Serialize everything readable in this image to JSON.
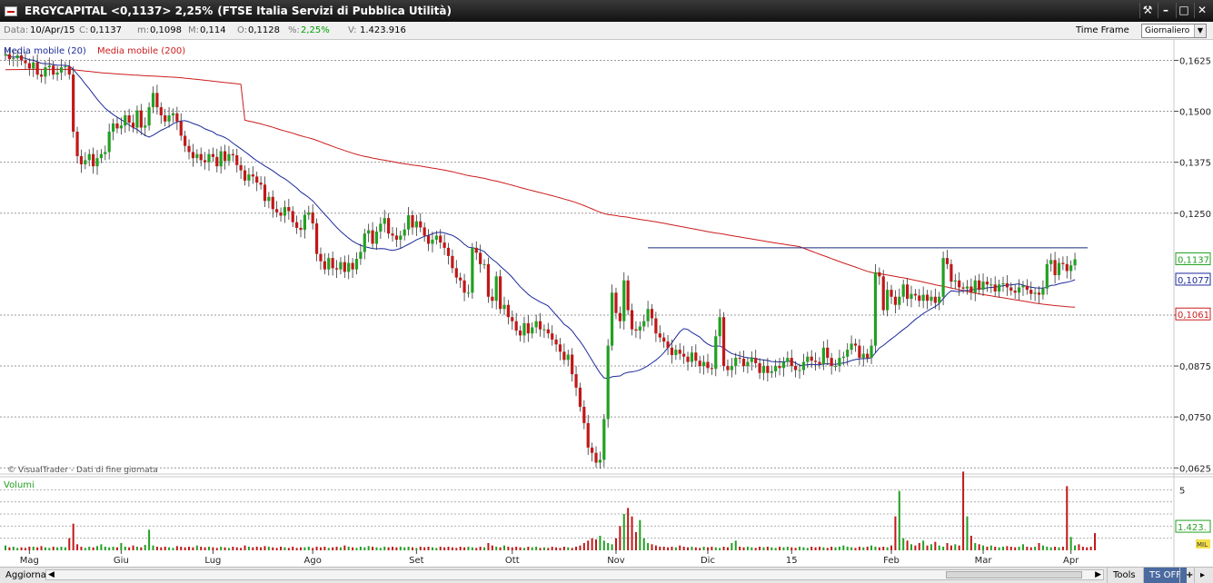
{
  "window": {
    "title_symbol": "ERGYCAPITAL <0,1137> 2,25%",
    "title_index": "(FTSE Italia Servizi di Pubblica Utilità)",
    "buttons": [
      "tools-icon",
      "minimize-icon",
      "maximize-icon",
      "close-icon"
    ]
  },
  "infobar": {
    "data_label": "Data:",
    "data_value": "10/Apr/15",
    "close_label": "C:",
    "close_value": "0,1137",
    "min_label": "m:",
    "min_value": "0,1098",
    "max_label": "M:",
    "max_value": "0,114",
    "open_label": "O:",
    "open_value": "0,1128",
    "pct_label": "%:",
    "pct_value": "2,25%",
    "vol_label": "V:",
    "vol_value": "1.423.916",
    "timeframe_label": "Time Frame",
    "timeframe_value": "Giornaliero"
  },
  "legend": {
    "ma20": "Media mobile (20)",
    "ma200": "Media mobile (200)",
    "volumes": "Volumi",
    "watermark": "© VisualTrader - Dati di fine giornata"
  },
  "bottom": {
    "refresh": "Aggiorna",
    "tools": "Tools",
    "tsoff": "TS OFF",
    "plus": "+"
  },
  "colors": {
    "up": "#22a022",
    "down": "#c01818",
    "ma20": "#1c2a9a",
    "ma200": "#cc1c1c",
    "grid": "#9a9a9a",
    "resistance": "#1a2a7a"
  },
  "chart_data": [
    {
      "type": "candlestick",
      "ylim": [
        0.061,
        0.1675
      ],
      "yticks": [
        "0,1625",
        "0,1500",
        "0,1375",
        "0,1250",
        "0,1000",
        "0,0875",
        "0,0750",
        "0,0625"
      ],
      "ytick_values": [
        0.1625,
        0.15,
        0.1375,
        0.125,
        0.1,
        0.0875,
        0.075,
        0.0625
      ],
      "xticks": [
        "Mag",
        "Giu",
        "Lug",
        "Ago",
        "Set",
        "Ott",
        "Nov",
        "Dic",
        "15",
        "Feb",
        "Mar",
        "Apr"
      ],
      "xtick_days": [
        6,
        29,
        52,
        77,
        103,
        127,
        153,
        176,
        197,
        222,
        245,
        267
      ],
      "last_close_label": "0,1137",
      "ma20_label": "0,1077",
      "ma200_label": "0,1061",
      "resistance_level": 0.1165,
      "resistance_from_day": 161,
      "closes": [
        0.164,
        0.1628,
        0.163,
        0.1637,
        0.1625,
        0.1618,
        0.1605,
        0.162,
        0.159,
        0.1585,
        0.1608,
        0.1612,
        0.159,
        0.1595,
        0.1608,
        0.161,
        0.159,
        0.145,
        0.139,
        0.137,
        0.138,
        0.1395,
        0.1365,
        0.1385,
        0.1395,
        0.14,
        0.145,
        0.147,
        0.1458,
        0.1465,
        0.149,
        0.1472,
        0.146,
        0.1502,
        0.146,
        0.1465,
        0.151,
        0.1545,
        0.151,
        0.149,
        0.1475,
        0.149,
        0.1495,
        0.1475,
        0.144,
        0.1415,
        0.14,
        0.1385,
        0.1395,
        0.138,
        0.1375,
        0.1395,
        0.1388,
        0.1365,
        0.1402,
        0.1378,
        0.1395,
        0.1392,
        0.1368,
        0.1355,
        0.133,
        0.1345,
        0.134,
        0.1325,
        0.132,
        0.128,
        0.129,
        0.126,
        0.1252,
        0.1244,
        0.1265,
        0.1255,
        0.1228,
        0.1214,
        0.1209,
        0.1246,
        0.1252,
        0.1225,
        0.115,
        0.1132,
        0.1112,
        0.114,
        0.1115,
        0.1112,
        0.113,
        0.1106,
        0.1128,
        0.1112,
        0.1138,
        0.1155,
        0.12,
        0.1208,
        0.1175,
        0.1205,
        0.1224,
        0.1238,
        0.12,
        0.1195,
        0.1185,
        0.1195,
        0.121,
        0.1245,
        0.1215,
        0.123,
        0.1215,
        0.1195,
        0.1175,
        0.1185,
        0.1195,
        0.1178,
        0.1165,
        0.1145,
        0.1115,
        0.1092,
        0.1085,
        0.1055,
        0.1055,
        0.1165,
        0.1153,
        0.1125,
        0.1125,
        0.1045,
        0.1035,
        0.1095,
        0.1015,
        0.1025,
        0.0995,
        0.0985,
        0.0962,
        0.095,
        0.098,
        0.0955,
        0.097,
        0.0985,
        0.0965,
        0.0965,
        0.0955,
        0.094,
        0.0928,
        0.091,
        0.089,
        0.0903,
        0.0855,
        0.0822,
        0.0775,
        0.0735,
        0.0675,
        0.0662,
        0.0638,
        0.0645,
        0.0745,
        0.0925,
        0.1055,
        0.1005,
        0.0985,
        0.1085,
        0.1012,
        0.0965,
        0.0962,
        0.0972,
        0.0985,
        0.1015,
        0.0992,
        0.0955,
        0.0945,
        0.0935,
        0.092,
        0.0902,
        0.0915,
        0.0905,
        0.0898,
        0.0885,
        0.0908,
        0.0888,
        0.0875,
        0.0885,
        0.087,
        0.0868,
        0.0948,
        0.0995,
        0.0875,
        0.0865,
        0.0875,
        0.0895,
        0.0893,
        0.0875,
        0.0885,
        0.0895,
        0.0882,
        0.0858,
        0.0875,
        0.0858,
        0.0862,
        0.0875,
        0.087,
        0.0885,
        0.0895,
        0.0875,
        0.0865,
        0.0865,
        0.0885,
        0.0898,
        0.0888,
        0.0885,
        0.088,
        0.092,
        0.0895,
        0.0875,
        0.0875,
        0.0895,
        0.0898,
        0.0915,
        0.093,
        0.0925,
        0.0895,
        0.0905,
        0.0895,
        0.0925,
        0.1105,
        0.1095,
        0.1012,
        0.1062,
        0.1045,
        0.1025,
        0.1045,
        0.1075,
        0.104,
        0.1052,
        0.1048,
        0.1035,
        0.105,
        0.1035,
        0.1045,
        0.103,
        0.1045,
        0.114,
        0.1125,
        0.1082,
        0.1085,
        0.1068,
        0.1065,
        0.107,
        0.1055,
        0.1085,
        0.1062,
        0.1082,
        0.1075,
        0.1075,
        0.1058,
        0.1075,
        0.1078,
        0.1068,
        0.106,
        0.1055,
        0.1068,
        0.1072,
        0.1062,
        0.1052,
        0.1055,
        0.105,
        0.1065,
        0.1125,
        0.1135,
        0.1098,
        0.1128,
        0.1125,
        0.1108,
        0.1122,
        0.1137
      ]
    },
    {
      "type": "bar",
      "title": "Volumi",
      "ylim": [
        0,
        6
      ],
      "yticks": [
        "5"
      ],
      "ytick_values": [
        5
      ],
      "last_value_label": "1.423.",
      "units_label": "MIL",
      "values": [
        0.4,
        0.25,
        0.3,
        0.2,
        0.25,
        0.2,
        0.3,
        0.3,
        0.25,
        0.35,
        0.25,
        0.2,
        0.3,
        0.25,
        0.3,
        0.25,
        1.0,
        2.2,
        0.5,
        0.3,
        0.2,
        0.3,
        0.25,
        0.35,
        0.5,
        0.3,
        0.25,
        0.3,
        0.25,
        0.6,
        0.3,
        0.25,
        0.4,
        0.3,
        0.25,
        0.45,
        1.7,
        0.4,
        0.3,
        0.25,
        0.3,
        0.25,
        0.2,
        0.35,
        0.3,
        0.25,
        0.3,
        0.25,
        0.4,
        0.3,
        0.25,
        0.3,
        0.25,
        0.2,
        0.3,
        0.25,
        0.2,
        0.3,
        0.25,
        0.2,
        0.4,
        0.3,
        0.25,
        0.3,
        0.25,
        0.35,
        0.3,
        0.25,
        0.2,
        0.3,
        0.25,
        0.2,
        0.3,
        0.2,
        0.25,
        0.25,
        0.3,
        0.2,
        0.3,
        0.25,
        0.3,
        0.2,
        0.25,
        0.3,
        0.25,
        0.4,
        0.3,
        0.25,
        0.2,
        0.3,
        0.25,
        0.35,
        0.3,
        0.25,
        0.2,
        0.3,
        0.25,
        0.3,
        0.25,
        0.3,
        0.25,
        0.3,
        0.25,
        0.2,
        0.3,
        0.25,
        0.3,
        0.25,
        0.2,
        0.3,
        0.25,
        0.3,
        0.25,
        0.2,
        0.3,
        0.25,
        0.3,
        0.25,
        0.2,
        0.3,
        0.25,
        0.6,
        0.4,
        0.3,
        0.25,
        0.4,
        0.3,
        0.25,
        0.3,
        0.25,
        0.2,
        0.3,
        0.25,
        0.3,
        0.2,
        0.25,
        0.2,
        0.3,
        0.25,
        0.2,
        0.3,
        0.25,
        0.2,
        0.3,
        0.4,
        0.6,
        0.8,
        1.0,
        0.9,
        1.2,
        0.8,
        0.6,
        0.5,
        1.0,
        2.0,
        3.0,
        3.5,
        2.8,
        1.5,
        2.5,
        1.0,
        0.6,
        0.5,
        0.4,
        0.3,
        0.3,
        0.25,
        0.3,
        0.25,
        0.4,
        0.3,
        0.25,
        0.3,
        0.25,
        0.2,
        0.3,
        0.25,
        0.3,
        0.25,
        0.2,
        0.3,
        0.25,
        0.6,
        0.8,
        0.3,
        0.25,
        0.3,
        0.25,
        0.2,
        0.3,
        0.25,
        0.3,
        0.25,
        0.2,
        0.3,
        0.25,
        0.3,
        0.25,
        0.2,
        0.3,
        0.25,
        0.2,
        0.3,
        0.25,
        0.3,
        0.25,
        0.2,
        0.3,
        0.25,
        0.3,
        0.4,
        0.3,
        0.25,
        0.2,
        0.3,
        0.25,
        0.3,
        0.4,
        0.3,
        0.25,
        0.3,
        0.25,
        0.4,
        2.8,
        4.9,
        1.0,
        0.8,
        0.5,
        0.4,
        0.6,
        0.8,
        0.4,
        0.5,
        0.7,
        0.4,
        0.3,
        0.6,
        0.4,
        0.5,
        0.4,
        6.5,
        2.8,
        1.2,
        0.6,
        0.5,
        0.4,
        0.3,
        0.4,
        0.3,
        0.25,
        0.3,
        0.35,
        0.3,
        0.25,
        0.3,
        0.5,
        0.3,
        0.25,
        0.3,
        0.6,
        0.4,
        0.3,
        0.25,
        0.3,
        0.25,
        0.3,
        5.3,
        1.1,
        0.4,
        0.5,
        0.3,
        0.25,
        0.3,
        1.42
      ]
    }
  ]
}
